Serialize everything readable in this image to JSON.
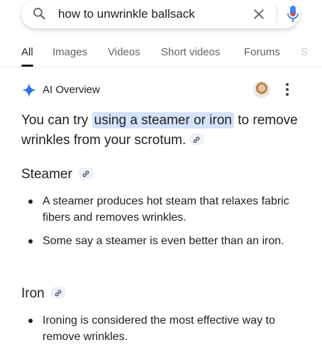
{
  "search": {
    "query": "how to unwrinkle ballsack"
  },
  "tabs": [
    {
      "label": "All",
      "active": true
    },
    {
      "label": "Images"
    },
    {
      "label": "Videos"
    },
    {
      "label": "Short videos"
    },
    {
      "label": "Forums"
    },
    {
      "label": "S"
    }
  ],
  "ai_overview": {
    "title": "AI Overview",
    "lead_before": "You can try ",
    "lead_highlight": "using a steamer or iron",
    "lead_after": " to remove wrinkles from your scrotum.",
    "sections": [
      {
        "heading": "Steamer",
        "bullets": [
          "A steamer produces hot steam that relaxes fabric fibers and removes wrinkles.",
          "Some say a steamer is even better than an iron."
        ]
      },
      {
        "heading": "Iron",
        "bullets": [
          "Ironing is considered the most effective way to remove wrinkles."
        ]
      }
    ]
  },
  "colors": {
    "highlight": "#d3e3fd",
    "link_chip": "#edf2fa",
    "accent_blue": "#1a73e8"
  },
  "icons": [
    "search-icon",
    "clear-icon",
    "mic-icon",
    "sparkle-icon",
    "more-icon",
    "link-icon"
  ]
}
